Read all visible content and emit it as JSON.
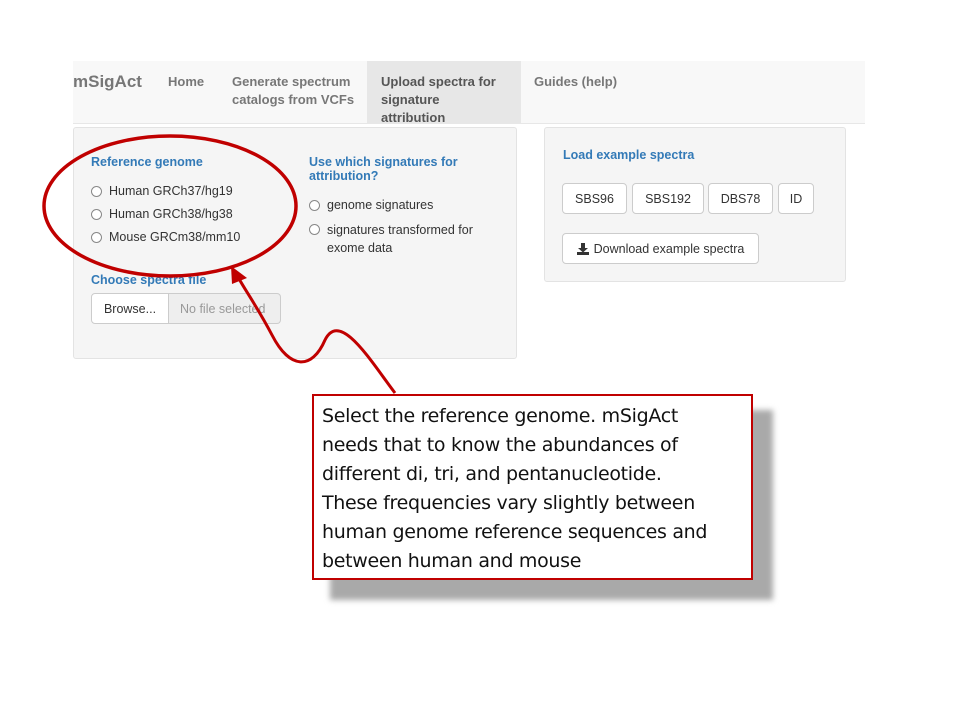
{
  "navbar": {
    "brand": "mSigAct",
    "items": [
      {
        "line1": "Home",
        "line2": ""
      },
      {
        "line1": "Generate spectrum",
        "line2": "catalogs from VCFs"
      },
      {
        "line1": "Upload spectra for",
        "line2": "signature attribution"
      },
      {
        "line1": "Guides (help)",
        "line2": ""
      }
    ]
  },
  "left_panel": {
    "reference_genome_label": "Reference genome",
    "genome_options": [
      "Human GRCh37/hg19",
      "Human GRCh38/hg38",
      "Mouse GRCm38/mm10"
    ],
    "signatures_label_line1": "Use which signatures for",
    "signatures_label_line2": "attribution?",
    "signature_options": [
      {
        "line1": "genome signatures",
        "line2": ""
      },
      {
        "line1": "signatures transformed for",
        "line2": "exome data"
      }
    ],
    "choose_file_label": "Choose spectra file",
    "browse_label": "Browse...",
    "no_file_label": "No file selected"
  },
  "right_panel": {
    "title": "Load example spectra",
    "example_buttons": [
      "SBS96",
      "SBS192",
      "DBS78",
      "ID"
    ],
    "download_label": "Download example spectra",
    "download_icon": "download-icon"
  },
  "callout": {
    "lines": [
      "Select the reference genome. mSigAct",
      "needs that to know the abundances of",
      "different di, tri, and pentanucleotide.",
      "These frequencies vary slightly between",
      "human genome reference sequences and",
      "between human and mouse"
    ],
    "border_color": "#c00000"
  },
  "annotation_color": "#c00000"
}
